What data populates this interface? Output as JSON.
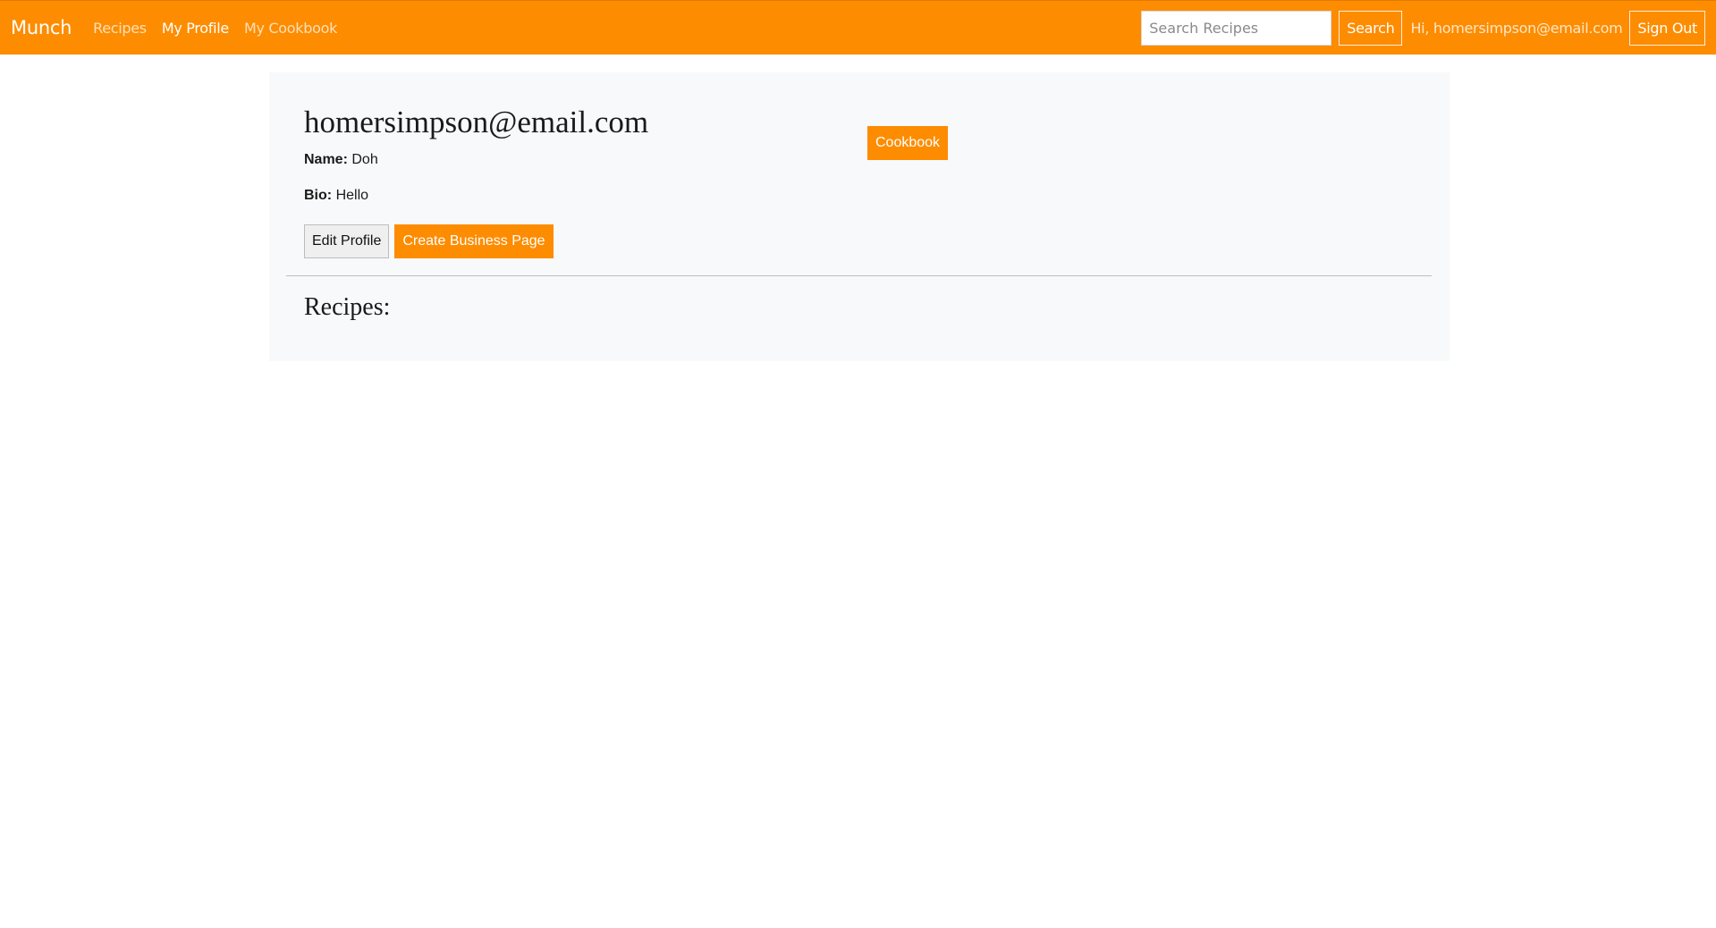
{
  "colors": {
    "brand_orange": "#fd8c00",
    "card_background": "#f8f9fa"
  },
  "navbar": {
    "brand": "Munch",
    "links": [
      {
        "label": "Recipes",
        "active": false
      },
      {
        "label": "My Profile",
        "active": true
      },
      {
        "label": "My Cookbook",
        "active": false
      }
    ],
    "search": {
      "placeholder": "Search Recipes",
      "value": "",
      "button_label": "Search"
    },
    "greeting": "Hi, homersimpson@email.com",
    "sign_out_label": "Sign Out"
  },
  "profile": {
    "email": "homersimpson@email.com",
    "name_label": "Name:",
    "name_value": "Doh",
    "bio_label": "Bio:",
    "bio_value": "Hello",
    "cookbook_label": "Cookbook",
    "edit_label": "Edit Profile",
    "business_label": "Create Business Page"
  },
  "recipes": {
    "heading": "Recipes:"
  }
}
